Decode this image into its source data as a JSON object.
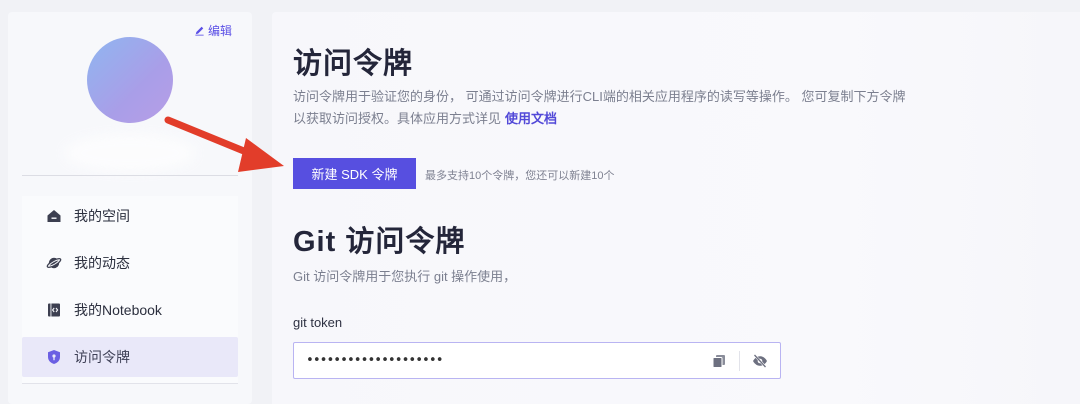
{
  "profile": {
    "edit_label": "编辑"
  },
  "sidebar": {
    "items": [
      {
        "label": "我的空间",
        "icon": "home-icon",
        "active": false
      },
      {
        "label": "我的动态",
        "icon": "planet-icon",
        "active": false
      },
      {
        "label": "我的Notebook",
        "icon": "code-notebook-icon",
        "active": false
      },
      {
        "label": "访问令牌",
        "icon": "shield-icon",
        "active": true
      }
    ]
  },
  "main": {
    "title": "访问令牌",
    "desc_line1": "访问令牌用于验证您的身份， 可通过访问令牌进行CLI端的相关应用程序的读写等操作。 您可复制下方令牌",
    "desc_line2": "以获取访问授权。具体应用方式详见",
    "doc_link": "使用文档",
    "new_button": "新建 SDK 令牌",
    "button_hint": "最多支持10个令牌，您还可以新建10个",
    "git_title": "Git 访问令牌",
    "git_desc": "Git 访问令牌用于您执行 git 操作使用，",
    "field_label": "git token",
    "token_value": "••••••••••••••••••••"
  },
  "colors": {
    "accent": "#574fe0",
    "annotation_arrow": "#e23d2a"
  }
}
